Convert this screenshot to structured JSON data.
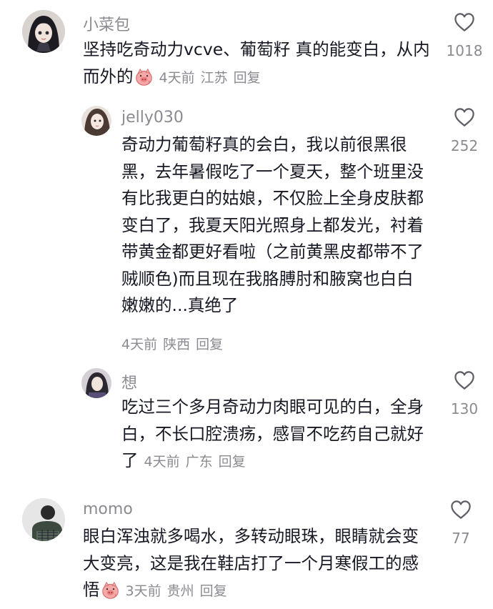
{
  "comments": [
    {
      "username": "小菜包",
      "text": "坚持吃奇动力vcve、葡萄籽 真的能变白，从内而外的",
      "emoji": "pig-emoji",
      "time": "4天前",
      "location": "江苏",
      "reply": "回复",
      "likes": "1018"
    },
    {
      "username": "jelly030",
      "text": "奇动力葡萄籽真的会白，我以前很黑很黑，去年暑假吃了一个夏天，整个班里没有比我更白的姑娘，不仅脸上全身皮肤都变白了，我夏天阳光照身上都发光，衬着带黄金都更好看啦（之前黄黑皮都带不了 贼顺色)而且现在我胳膊肘和腋窝也白白嫩嫩的...真绝了",
      "time": "4天前",
      "location": "陕西",
      "reply": "回复",
      "likes": "252"
    },
    {
      "username": "想",
      "text": "吃过三个多月奇动力肉眼可见的白，全身白，不长口腔溃疡，感冒不吃药自己就好了",
      "time": "4天前",
      "location": "广东",
      "reply": "回复",
      "likes": "130"
    },
    {
      "username": "momo",
      "text": "眼白浑浊就多喝水，多转动眼珠，眼睛就会变大变亮，这是我在鞋店打了一个月寒假工的感悟",
      "emoji": "pig-emoji",
      "time": "3天前",
      "location": "贵州",
      "reply": "回复",
      "likes": "77"
    }
  ],
  "colors": {
    "text": "#161823",
    "secondary": "#8a8b91",
    "background": "#ffffff"
  },
  "icons": {
    "like": "heart-outline-icon",
    "emoji": "pig-emoji"
  }
}
